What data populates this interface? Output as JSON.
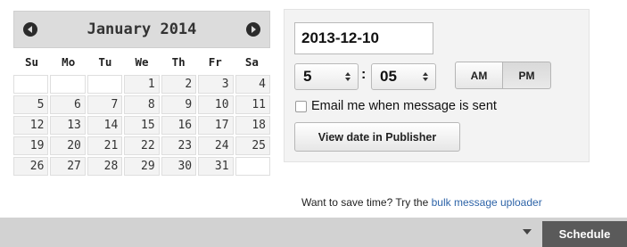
{
  "calendar": {
    "month_title": "January 2014",
    "weekdays": [
      "Su",
      "Mo",
      "Tu",
      "We",
      "Th",
      "Fr",
      "Sa"
    ],
    "weeks": [
      [
        "",
        "",
        "",
        "1",
        "2",
        "3",
        "4"
      ],
      [
        "5",
        "6",
        "7",
        "8",
        "9",
        "10",
        "11"
      ],
      [
        "12",
        "13",
        "14",
        "15",
        "16",
        "17",
        "18"
      ],
      [
        "19",
        "20",
        "21",
        "22",
        "23",
        "24",
        "25"
      ],
      [
        "26",
        "27",
        "28",
        "29",
        "30",
        "31",
        ""
      ]
    ],
    "prev_icon": "chevron-left-icon",
    "next_icon": "chevron-right-icon"
  },
  "scheduler": {
    "date_value": "2013-12-10",
    "hour_value": "5",
    "minute_value": "05",
    "separator": ":",
    "am_label": "AM",
    "pm_label": "PM",
    "selected_period": "PM",
    "email_label": "Email me when message is sent",
    "email_checked": false,
    "view_button_label": "View date in Publisher"
  },
  "tip": {
    "text": "Want to save time? Try the ",
    "link_text": "bulk message uploader",
    "link_color": "#2e64a8"
  },
  "bottom_bar": {
    "schedule_label": "Schedule",
    "dropdown_icon": "caret-down-icon",
    "button_color": "#5a5a5a"
  }
}
